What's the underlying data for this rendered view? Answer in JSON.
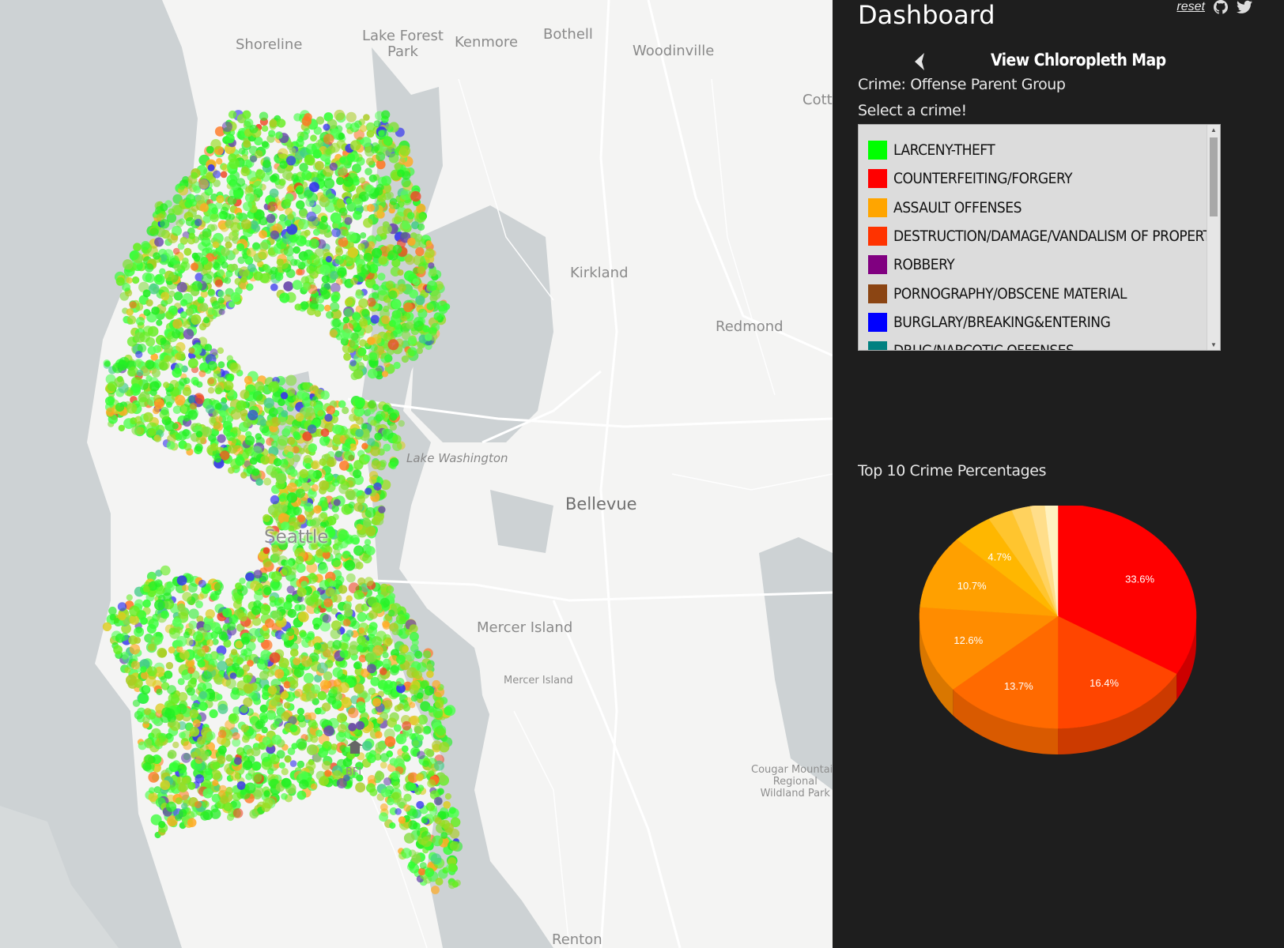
{
  "map": {
    "places": {
      "shoreline": "Shoreline",
      "lake_forest_park": "Lake Forest\nPark",
      "kenmore": "Kenmore",
      "bothell": "Bothell",
      "woodinville": "Woodinville",
      "cott": "Cott",
      "kirkland": "Kirkland",
      "redmond": "Redmond",
      "lake_washington": "Lake Washington",
      "bellevue": "Bellevue",
      "seattle": "Seattle",
      "mercer_island_big": "Mercer Island",
      "mercer_island_small": "Mercer Island",
      "bfi": "BFI",
      "cougar": "Cougar Mountain\nRegional\nWildland Park",
      "renton": "Renton"
    }
  },
  "panel": {
    "title": "Dashboard",
    "reset_label": "reset",
    "icons": [
      "github-icon",
      "twitter-icon"
    ],
    "view_link": "View Chloropleth Map",
    "crime_group_label": "Crime: Offense Parent Group",
    "select_label": "Select a crime!",
    "crimes": [
      {
        "name": "LARCENY-THEFT",
        "color": "#00ff00"
      },
      {
        "name": "COUNTERFEITING/FORGERY",
        "color": "#ff0000"
      },
      {
        "name": "ASSAULT OFFENSES",
        "color": "#ffa500"
      },
      {
        "name": "DESTRUCTION/DAMAGE/VANDALISM OF PROPERTY",
        "color": "#ff3300"
      },
      {
        "name": "ROBBERY",
        "color": "#800080"
      },
      {
        "name": "PORNOGRAPHY/OBSCENE MATERIAL",
        "color": "#8b4513"
      },
      {
        "name": "BURGLARY/BREAKING&ENTERING",
        "color": "#0000ff"
      },
      {
        "name": "DRUG/NARCOTIC OFFENSES",
        "color": "#008080"
      }
    ],
    "chart_title": "Top 10 Crime Percentages"
  },
  "chart_data": {
    "type": "pie",
    "title": "Top 10 Crime Percentages",
    "values": [
      33.6,
      16.4,
      13.7,
      12.6,
      10.7,
      4.7,
      2.9,
      2.2,
      1.7,
      1.5
    ],
    "labels": [
      "33.6%",
      "16.4%",
      "13.7%",
      "12.6%",
      "10.7%",
      "4.7%",
      "",
      "",
      "",
      ""
    ],
    "colors": [
      "#ff0000",
      "#ff4500",
      "#ff6a00",
      "#ff8c00",
      "#ffa000",
      "#ffb700",
      "#ffc52e",
      "#ffd25e",
      "#ffde8a",
      "#fff2c0"
    ],
    "side_colors": [
      "#cc0000",
      "#cc3a00",
      "#d95a00",
      "#d97700",
      "#d98700",
      "#d99c00",
      "#d9a826",
      "#d9b350",
      "#d9bd75",
      "#d9cea3"
    ]
  }
}
